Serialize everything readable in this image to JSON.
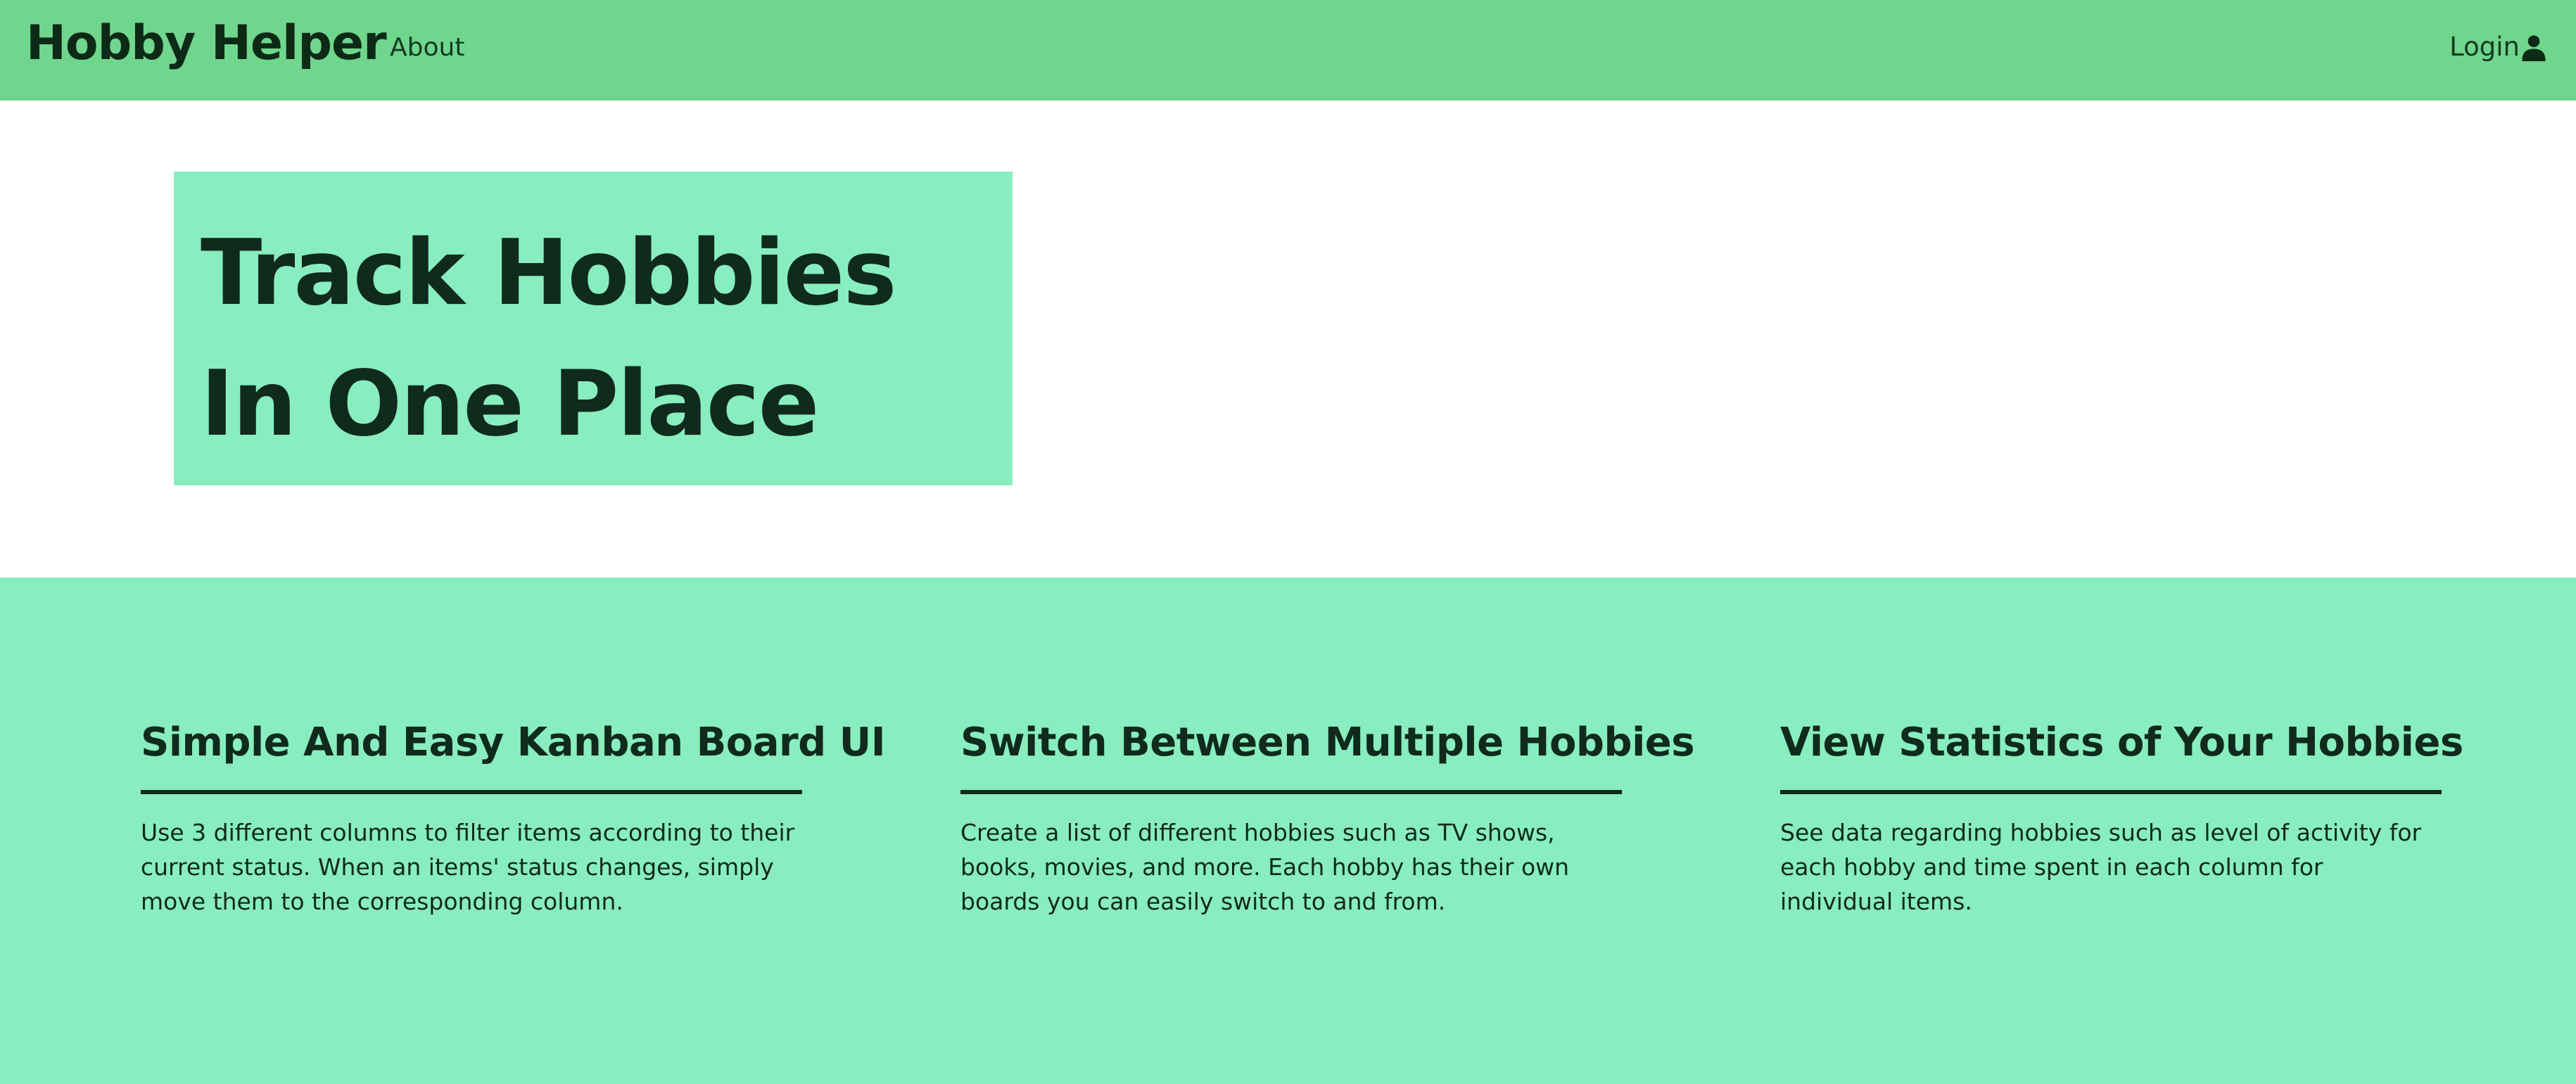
{
  "navbar": {
    "brand": "Hobby Helper",
    "about_label": "About",
    "login_label": "Login",
    "login_icon": "user-icon",
    "background": "#70d68d"
  },
  "hero": {
    "title": "Track Hobbies In One Place",
    "box_color": "#88edbf"
  },
  "features": {
    "background": "#88edbf",
    "items": [
      {
        "title": "Simple And Easy Kanban Board UI",
        "description": "Use 3 different columns to filter items according to their current status. When an items' status changes, simply move them to the corresponding column."
      },
      {
        "title": "Switch Between Multiple Hobbies",
        "description": "Create a list of different hobbies such as TV shows, books, movies, and more. Each hobby has their own boards you can easily switch to and from."
      },
      {
        "title": "View Statistics of Your Hobbies",
        "description": "See data regarding hobbies such as level of activity for each hobby and time spent in each column for individual items."
      }
    ]
  }
}
